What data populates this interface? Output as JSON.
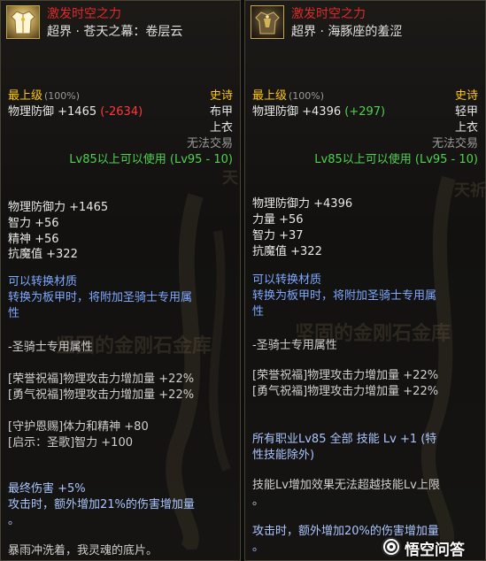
{
  "left": {
    "title": "激发时空之力",
    "subtitle": "超界 · 苍天之幕：卷层云",
    "grade": "最上级",
    "grade_pct": "(100%)",
    "rarity": "史诗",
    "armor_type": "布甲",
    "slot": "上衣",
    "phys_def_label": "物理防御 +1465",
    "phys_def_diff": "(-2634)",
    "trade": "无法交易",
    "level_req": "Lv85以上可以使用 (Lv95 - 10)",
    "stats": [
      "物理防御力 +1465",
      "智力 +56",
      "精神 +56",
      "抗魔值 +322"
    ],
    "convert_1": "可以转换材质",
    "convert_2": "转换为板甲时，将附加圣骑士专用属",
    "convert_3": "性",
    "paladin": "-圣骑士专用属性",
    "bless_1": "[荣誉祝福]物理攻击力增加量 +22%",
    "bless_2": "[勇气祝福]物理攻击力增加量 +22%",
    "grace_1": "[守护恩赐]体力和精神 +80",
    "grace_2": "[启示：圣歌]智力 +100",
    "final_1": "最终伤害 +5%",
    "final_2": "攻击时，额外增加21%的伤害增加量",
    "final_3": "。",
    "flavor": "暴雨冲洗着，我灵魂的底片。",
    "watermark": "坚固的金刚石金库",
    "side_text": "天"
  },
  "right": {
    "title": "激发时空之力",
    "subtitle": "超界 · 海豚座的羞涩",
    "grade": "最上级",
    "grade_pct": "(100%)",
    "rarity": "史诗",
    "armor_type": "轻甲",
    "slot": "上衣",
    "phys_def_label": "物理防御 +4396",
    "phys_def_diff": "(+297)",
    "trade": "无法交易",
    "level_req": "Lv85以上可以使用 (Lv95 - 10)",
    "stats": [
      "物理防御力 +4396",
      "力量 +56",
      "智力 +37",
      "抗魔值 +322"
    ],
    "convert_1": "可以转换材质",
    "convert_2": "转换为板甲时，将附加圣骑士专用属",
    "convert_3": "性",
    "paladin": "-圣骑士专用属性",
    "bless_1": "[荣誉祝福]物理攻击力增加量 +22%",
    "bless_2": "[勇气祝福]物理攻击力增加量 +22%",
    "skill_1": "所有职业Lv85 全部 技能 Lv +1 (特",
    "skill_2": "性技能除外)",
    "note_1": "技能Lv增加效果无法超越技能Lv上限",
    "note_2": "。",
    "attack_1": "攻击时，额外增加20%的伤害增加量",
    "attack_2": "。",
    "watermark": "坚固的金刚石金库",
    "side_text": "天祈"
  },
  "brand": "悟空问答",
  "colors": {
    "title_red": "#e02a2a",
    "grade_gold": "#ffc800",
    "level_green": "#4fd24f",
    "diff_red": "#ff3a3a",
    "diff_green": "#4fd24f",
    "text_blue": "#7fa8ff"
  },
  "icons": [
    "robe-armor-icon",
    "light-armor-icon",
    "wukong-logo-icon"
  ]
}
